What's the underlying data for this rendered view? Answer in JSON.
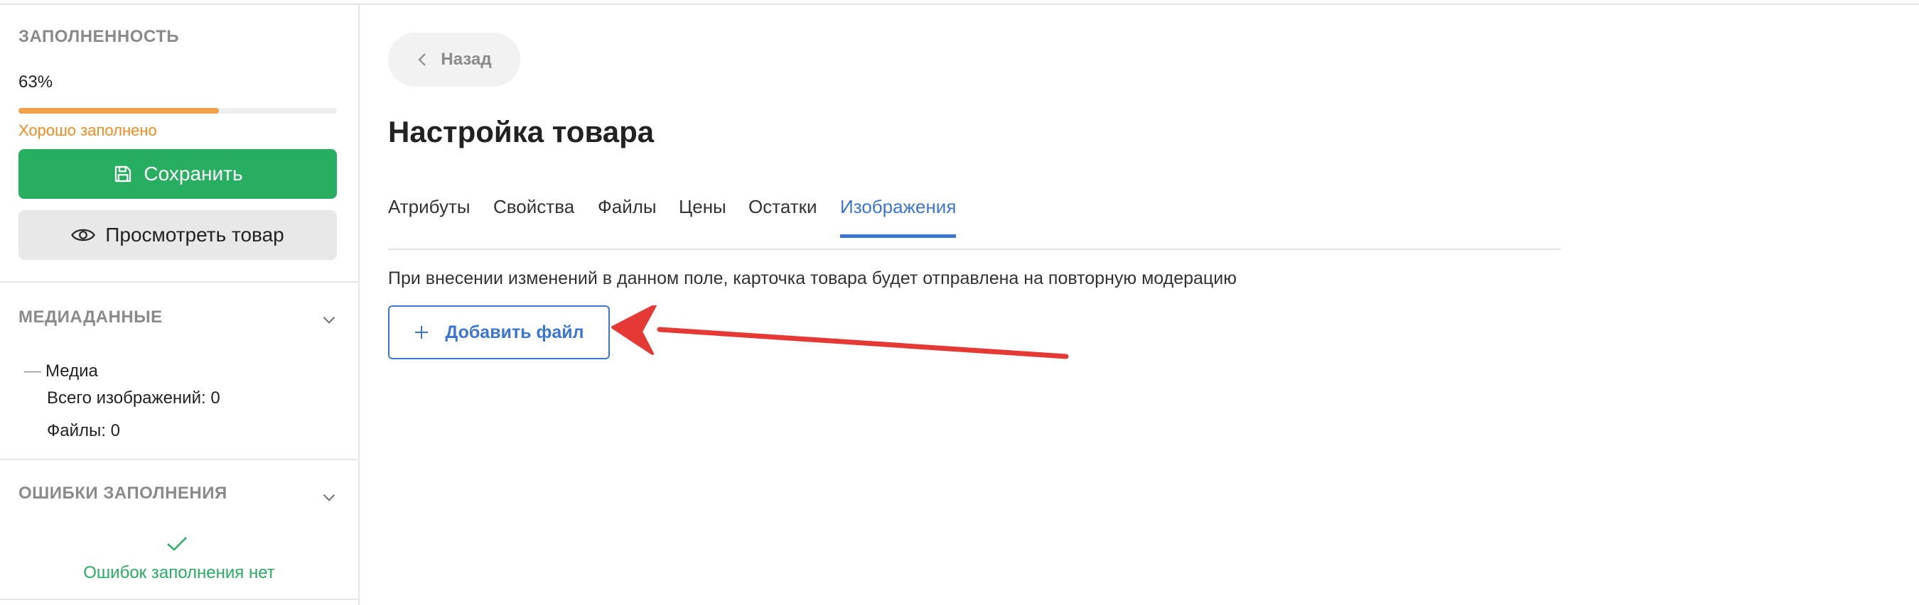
{
  "sidebar": {
    "completeness": {
      "title": "ЗАПОЛНЕННОСТЬ",
      "percent_text": "63%",
      "progress_value": 0.63,
      "status": "Хорошо заполнено"
    },
    "save_button": "Сохранить",
    "view_button": "Просмотреть товар",
    "media": {
      "title": "МЕДИАДАННЫЕ",
      "group_label": "Медиа",
      "total_images": "Всего изображений: 0",
      "files": "Файлы: 0"
    },
    "errors": {
      "title": "ОШИБКИ ЗАПОЛНЕНИЯ",
      "status": "Ошибок заполнения нет"
    }
  },
  "main": {
    "back_button": "Назад",
    "page_title": "Настройка товара",
    "tabs": [
      {
        "label": "Атрибуты"
      },
      {
        "label": "Свойства"
      },
      {
        "label": "Файлы"
      },
      {
        "label": "Цены"
      },
      {
        "label": "Остатки"
      },
      {
        "label": "Изображения"
      }
    ],
    "active_tab": "Изображения",
    "notice": "При внесении изменений в данном поле, карточка товара будет отправлена на повторную модерацию",
    "add_file_button": "Добавить файл"
  },
  "colors": {
    "accent_blue": "#3b76d4",
    "save_green": "#27ae60",
    "progress_orange": "#f0a14a",
    "annotation_arrow": "#e53935"
  },
  "icons": [
    "save-icon",
    "eye-icon",
    "chevron-down-icon",
    "check-icon",
    "chevron-left-icon",
    "plus-icon"
  ]
}
